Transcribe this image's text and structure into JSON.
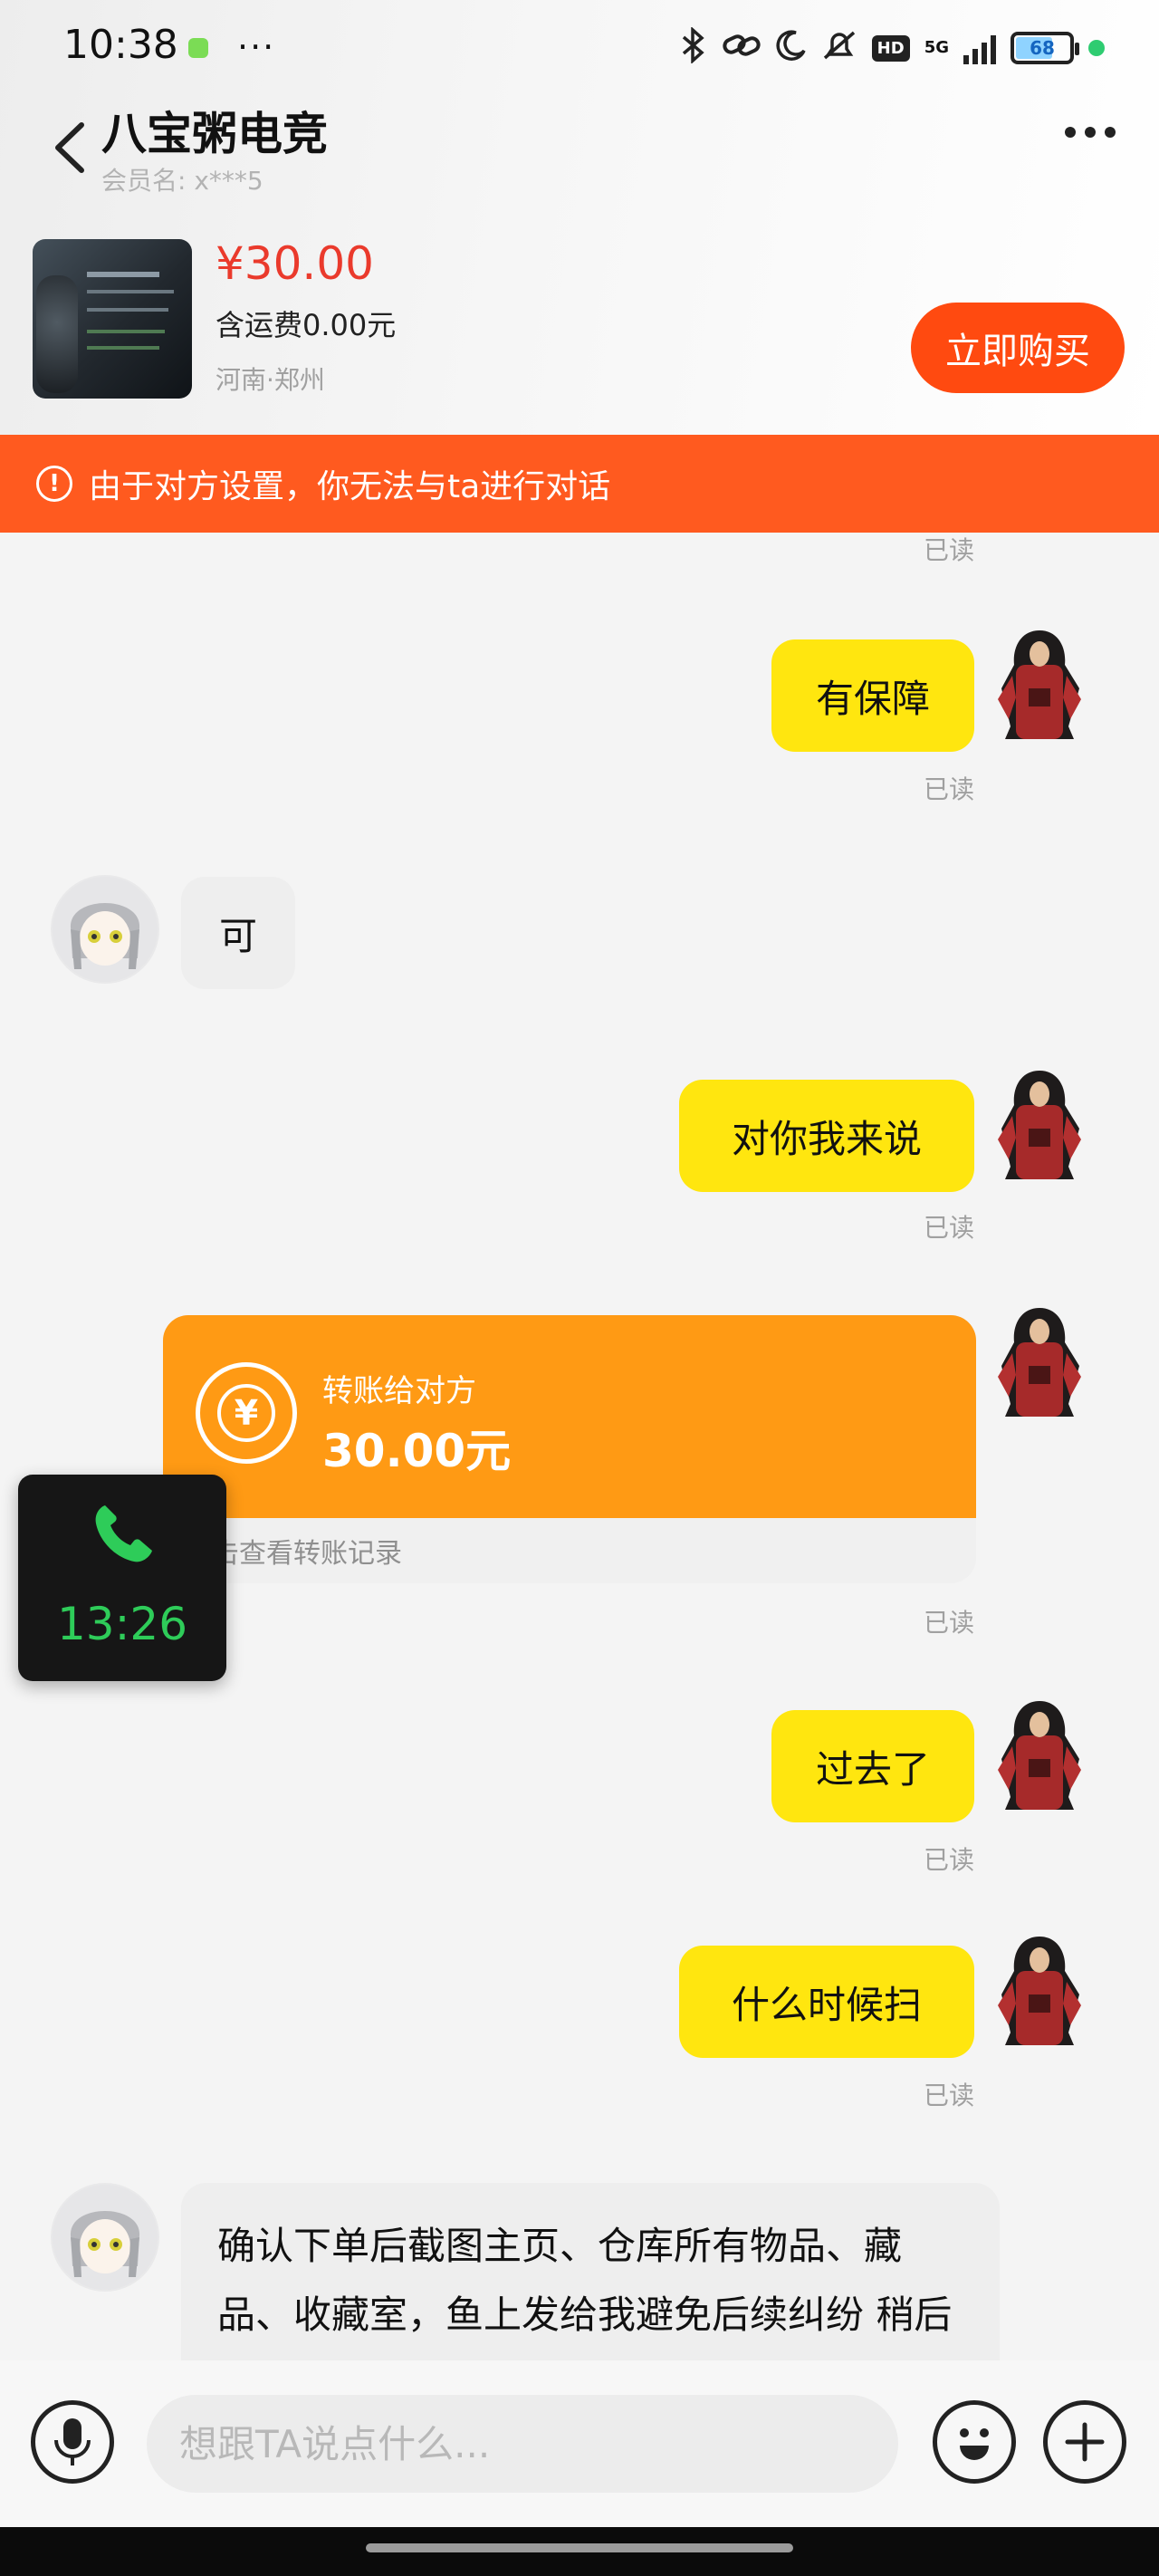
{
  "status_bar": {
    "time": "10:38",
    "more": "···",
    "icons": [
      "bluetooth-icon",
      "link-icon",
      "moon-icon",
      "mute-icon",
      "hd-icon",
      "5g-icon",
      "signal-icon",
      "battery-icon",
      "active-dot-icon"
    ],
    "hd": "HD",
    "net": "5G",
    "battery": "68"
  },
  "header": {
    "title": "八宝粥电竞",
    "member": "会员名: x***5"
  },
  "product": {
    "price": "¥30.00",
    "shipping": "含运费0.00元",
    "location": "河南·郑州",
    "buy_label": "立即购买"
  },
  "banner": {
    "icon": "!",
    "text": "由于对方设置，你无法与ta进行对话"
  },
  "messages": {
    "read_label": "已读",
    "m1": "有保障",
    "m2": "可",
    "m3": "对你我来说",
    "m5": "过去了",
    "m6": "什么时候扫",
    "m7": "确认下单后截图主页、仓库所有物品、藏品、收藏室，鱼上发给我避免后续纠纷 稍后给你派单 发🐧给我 我"
  },
  "transfer": {
    "label": "转账给对方",
    "amount": "30.00元",
    "link": "点击查看转账记录"
  },
  "call": {
    "duration": "13:26"
  },
  "input": {
    "placeholder": "想跟TA说点什么..."
  },
  "colors": {
    "accent": "#ff4a10",
    "banner": "#ff5a1f",
    "my_bubble": "#ffe60f",
    "transfer": "#ff9a14",
    "price": "#ea3a2c",
    "call_green": "#2ecc59"
  }
}
